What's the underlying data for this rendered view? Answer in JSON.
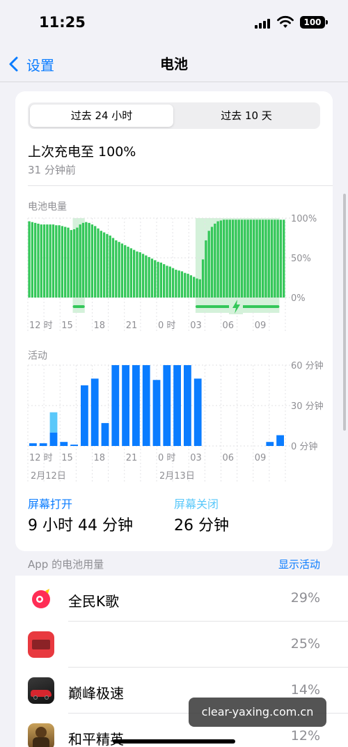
{
  "status_bar": {
    "time": "11:25",
    "battery": "100"
  },
  "nav": {
    "back_label": "设置",
    "title": "电池"
  },
  "segments": {
    "active": "过去 24 小时",
    "inactive": "过去 10 天"
  },
  "last_charge": {
    "title": "上次充电至 100%",
    "time": "31 分钟前"
  },
  "battery_chart": {
    "label": "电池电量",
    "y_ticks": [
      "100%",
      "50%",
      "0%"
    ],
    "x_ticks": [
      "12 时",
      "15",
      "18",
      "21",
      "0 时",
      "03",
      "06",
      "09"
    ]
  },
  "activity_chart": {
    "label": "活动",
    "y_ticks": [
      "60 分钟",
      "30 分钟",
      "0 分钟"
    ],
    "x_ticks": [
      "12 时",
      "15",
      "18",
      "21",
      "0 时",
      "03",
      "06",
      "09"
    ],
    "dates": [
      "2月12日",
      "2月13日"
    ]
  },
  "screen": {
    "on_label": "屏幕打开",
    "on_value": "9 小时 44 分钟",
    "off_label": "屏幕关闭",
    "off_value": "26 分钟"
  },
  "usage": {
    "header": "App 的电池用量",
    "show_activity": "显示活动"
  },
  "apps": [
    {
      "name": "全民K歌",
      "percent": "29%",
      "icon": "kge-app-icon"
    },
    {
      "name": "",
      "percent": "25%",
      "icon": "red-app-icon"
    },
    {
      "name": "巅峰极速",
      "percent": "14%",
      "icon": "racing-game-icon"
    },
    {
      "name": "和平精英",
      "percent": "12%",
      "icon": "shooter-game-icon"
    }
  ],
  "watermark": "clear-yaxing.com.cn",
  "colors": {
    "accent": "#0a7cff",
    "battery_green": "#34c759",
    "screen_on": "#0a7cff",
    "screen_off": "#5ac8fa"
  },
  "chart_data": [
    {
      "type": "bar",
      "title": "电池电量",
      "y_unit": "%",
      "ylim": [
        0,
        100
      ],
      "x_ticks": [
        "12 时",
        "15",
        "18",
        "21",
        "0 时",
        "03",
        "06",
        "09"
      ],
      "values": [
        96,
        95,
        94,
        93,
        92,
        92,
        92,
        92,
        92,
        91,
        91,
        90,
        89,
        88,
        85,
        86,
        88,
        92,
        94,
        95,
        94,
        92,
        90,
        87,
        84,
        82,
        80,
        78,
        75,
        72,
        70,
        68,
        66,
        64,
        62,
        60,
        58,
        57,
        55,
        53,
        51,
        49,
        47,
        45,
        44,
        42,
        40,
        39,
        37,
        35,
        34,
        33,
        31,
        30,
        28,
        26,
        24,
        23,
        48,
        72,
        84,
        89,
        93,
        96,
        97,
        98,
        98,
        98,
        98,
        98,
        98,
        98,
        98,
        98,
        98,
        98,
        98,
        98,
        98,
        98,
        98,
        98,
        98,
        98,
        98,
        98
      ],
      "charging_periods": [
        [
          15,
          18
        ],
        [
          56,
          83
        ]
      ]
    },
    {
      "type": "bar",
      "title": "活动",
      "y_unit": "分钟",
      "ylim": [
        0,
        60
      ],
      "x_ticks": [
        "12 时",
        "15",
        "18",
        "21",
        "0 时",
        "03",
        "06",
        "09"
      ],
      "series": [
        {
          "name": "屏幕打开",
          "values": [
            2,
            2,
            10,
            3,
            1,
            45,
            50,
            17,
            60,
            60,
            60,
            60,
            49,
            60,
            60,
            60,
            50,
            0,
            0,
            0,
            0,
            0,
            0,
            3,
            8
          ]
        },
        {
          "name": "屏幕关闭",
          "values": [
            0,
            0,
            15,
            0,
            0,
            0,
            0,
            0,
            0,
            0,
            0,
            0,
            0,
            0,
            0,
            0,
            0,
            0,
            0,
            0,
            0,
            0,
            0,
            0,
            0
          ]
        }
      ]
    }
  ]
}
